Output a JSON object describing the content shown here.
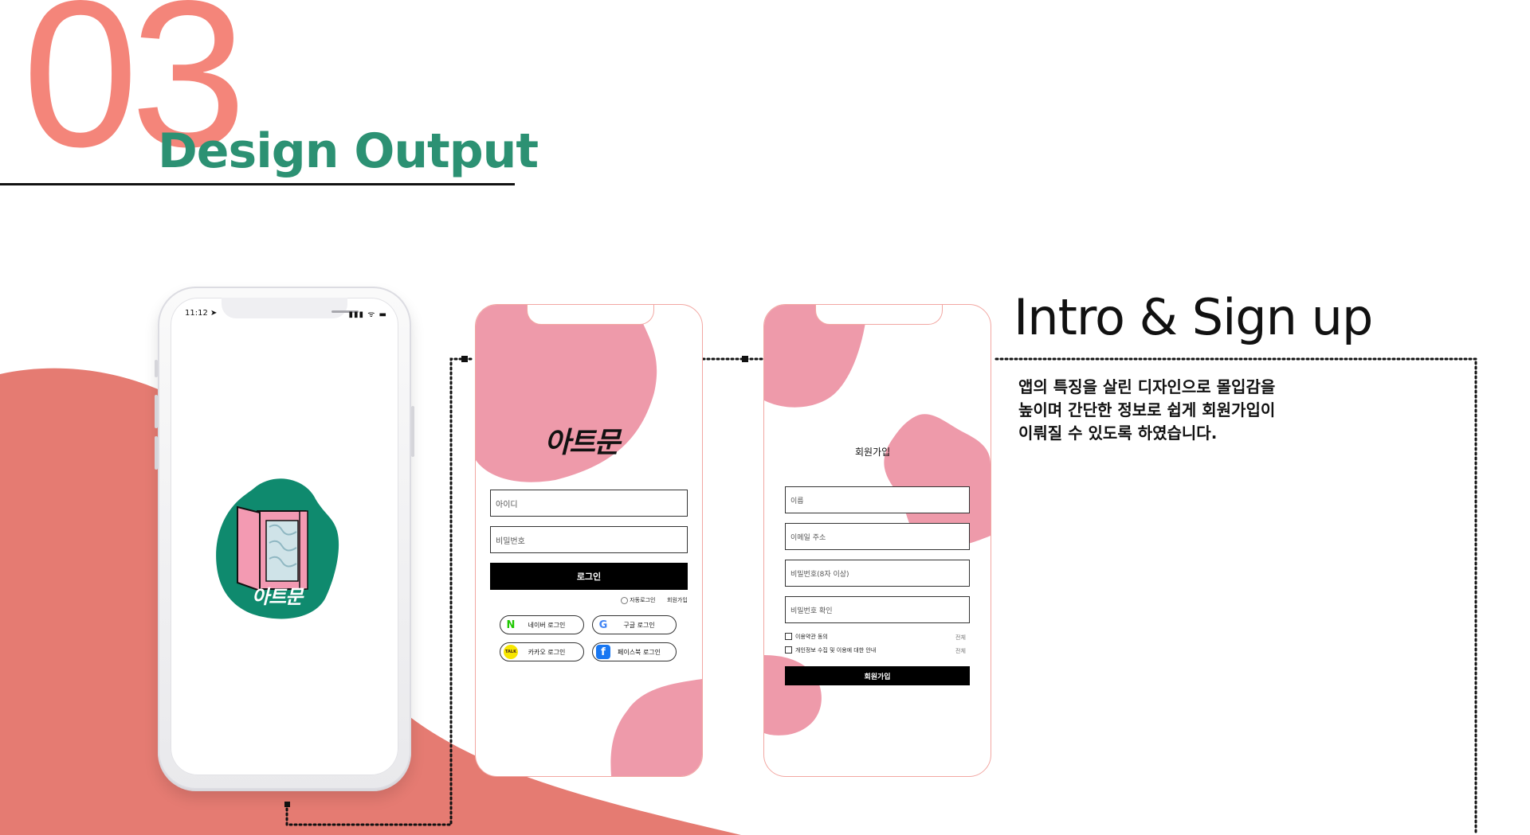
{
  "header": {
    "number": "03",
    "title": "Design Output"
  },
  "colors": {
    "coral": "#f4857a",
    "bg_blob": "#e57b72",
    "teal": "#2c9173",
    "pink_blob": "#ee9aaa",
    "logo_green": "#0f8a6e",
    "logo_pink": "#f39ab2"
  },
  "phone_intro": {
    "status_time": "11:12 ➤",
    "status_icons": "▮▮▮ ᯤ ▬",
    "logo_text": "아트문"
  },
  "phone_login": {
    "brand": "아트문",
    "id_placeholder": "아이디",
    "password_placeholder": "비밀번호",
    "login_button": "로그인",
    "auto_login": "자동로그인",
    "sign_up_link": "회원가입",
    "social": [
      {
        "label": "네이버 로그인",
        "icon": "naver-icon",
        "glyph": "N",
        "color": "#1ec800"
      },
      {
        "label": "구글 로그인",
        "icon": "google-icon",
        "glyph": "G",
        "color": "#4285f4"
      },
      {
        "label": "카카오 로그인",
        "icon": "kakao-icon",
        "glyph": "TALK",
        "color": "#3c1e1e"
      },
      {
        "label": "페이스북 로그인",
        "icon": "facebook-icon",
        "glyph": "f",
        "color": "#ffffff"
      }
    ]
  },
  "phone_signup": {
    "title": "회원가입",
    "name_placeholder": "이름",
    "email_placeholder": "이메일 주소",
    "password_placeholder": "비밀번호(8자 이상)",
    "password_confirm_placeholder": "비밀번호 확인",
    "terms_label": "이용약관 동의",
    "privacy_label": "개인정보 수집 및 이용에 대한 안내",
    "view_all": "전체",
    "submit_button": "회원가입"
  },
  "intro": {
    "title": "Intro & Sign up",
    "description_lines": [
      "앱의 특징을 살린 디자인으로 몰입감을",
      "높이며 간단한 정보로 쉽게 회원가입이",
      "이뤄질 수 있도록 하였습니다."
    ]
  }
}
